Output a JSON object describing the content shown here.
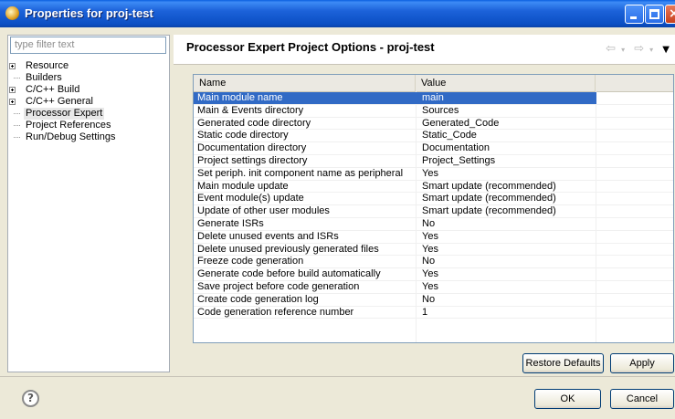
{
  "window": {
    "title": "Properties for proj-test"
  },
  "filter": {
    "placeholder": "type filter text"
  },
  "tree": [
    {
      "label": "Resource",
      "expandable": true
    },
    {
      "label": "Builders",
      "expandable": false
    },
    {
      "label": "C/C++ Build",
      "expandable": true
    },
    {
      "label": "C/C++ General",
      "expandable": true
    },
    {
      "label": "Processor Expert",
      "expandable": false,
      "selected": true
    },
    {
      "label": "Project References",
      "expandable": false
    },
    {
      "label": "Run/Debug Settings",
      "expandable": false
    }
  ],
  "page": {
    "title": "Processor Expert Project Options - proj-test"
  },
  "table": {
    "headers": {
      "name": "Name",
      "value": "Value"
    },
    "rows": [
      {
        "name": "Main module name",
        "value": "main",
        "selected": true
      },
      {
        "name": "Main & Events directory",
        "value": "Sources"
      },
      {
        "name": "Generated code directory",
        "value": "Generated_Code"
      },
      {
        "name": "Static code directory",
        "value": "Static_Code"
      },
      {
        "name": "Documentation directory",
        "value": "Documentation"
      },
      {
        "name": "Project settings directory",
        "value": "Project_Settings"
      },
      {
        "name": "Set periph. init component name as peripheral",
        "value": "Yes"
      },
      {
        "name": "Main module update",
        "value": "Smart update (recommended)"
      },
      {
        "name": "Event module(s) update",
        "value": "Smart update (recommended)"
      },
      {
        "name": "Update of other user modules",
        "value": "Smart update (recommended)"
      },
      {
        "name": "Generate ISRs",
        "value": "No"
      },
      {
        "name": "Delete unused events and ISRs",
        "value": "Yes"
      },
      {
        "name": "Delete unused previously generated files",
        "value": "Yes"
      },
      {
        "name": "Freeze code generation",
        "value": "No"
      },
      {
        "name": "Generate code before build automatically",
        "value": "Yes"
      },
      {
        "name": "Save project before code generation",
        "value": "Yes"
      },
      {
        "name": "Create code generation log",
        "value": "No"
      },
      {
        "name": "Code generation reference number",
        "value": "1"
      }
    ]
  },
  "buttons": {
    "restore_defaults": "Restore Defaults",
    "apply": "Apply",
    "ok": "OK",
    "cancel": "Cancel",
    "help": "?"
  },
  "colors": {
    "selection": "#316ac5",
    "titlebar": "#0b4fc4"
  },
  "icons": [
    "app-icon",
    "minimize-icon",
    "maximize-icon",
    "close-icon",
    "back-icon",
    "forward-icon",
    "view-menu-icon",
    "help-icon",
    "expand-icon"
  ]
}
